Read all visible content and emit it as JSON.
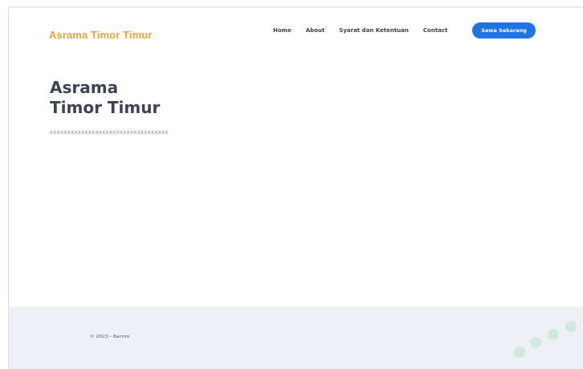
{
  "header": {
    "brand": "Asrama Timor Timur",
    "nav": [
      {
        "label": "Home"
      },
      {
        "label": "About"
      },
      {
        "label": "Syarat dan Ketentuan"
      },
      {
        "label": "Contact"
      }
    ],
    "cta_label": "Sewa Sekarang"
  },
  "hero": {
    "title_line1": "Asrama",
    "title_line2": "Timor Timur",
    "subtitle": "xxxxxxxxxxxxxxxxxxxxxxxxxxxxxxxxxx"
  },
  "footer": {
    "copyright": "© 2023 - Barros"
  },
  "colors": {
    "brand": "#f0a23b",
    "accent": "#1f74e3",
    "footer_bg": "#edf0f4",
    "text_dark": "#3d4553"
  }
}
